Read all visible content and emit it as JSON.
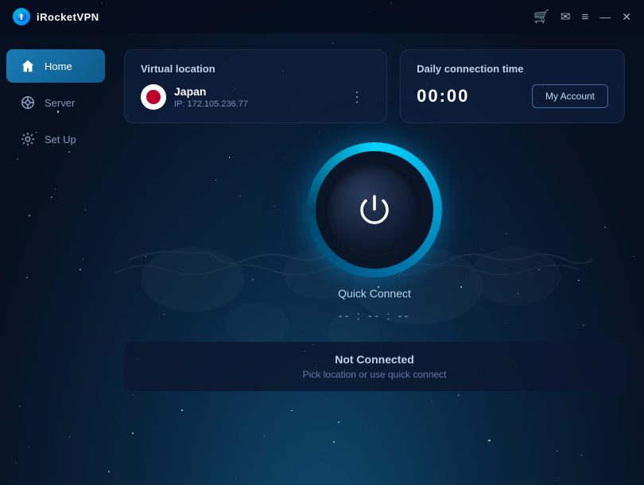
{
  "app": {
    "title": "iRocketVPN",
    "logo_char": "🚀"
  },
  "titlebar": {
    "cart_icon": "🛒",
    "mail_icon": "✉",
    "menu_icon": "≡",
    "minimize_icon": "—",
    "close_icon": "✕"
  },
  "sidebar": {
    "items": [
      {
        "id": "home",
        "label": "Home",
        "icon": "🏠",
        "active": true
      },
      {
        "id": "server",
        "label": "Server",
        "icon": "⊙",
        "active": false
      },
      {
        "id": "setup",
        "label": "Set Up",
        "icon": "⚙",
        "active": false
      }
    ]
  },
  "virtual_location": {
    "card_label": "Virtual location",
    "country": "Japan",
    "ip": "IP: 172.105.236.77",
    "flag": "🇯🇵",
    "menu_icon": "⋮"
  },
  "daily_connection": {
    "card_label": "Daily connection time",
    "time": "00:00",
    "my_account_label": "My Account"
  },
  "power": {
    "quick_connect_label": "Quick Connect",
    "timer": "-- : -- : --"
  },
  "status": {
    "title": "Not Connected",
    "subtitle": "Pick location or use quick connect"
  },
  "colors": {
    "accent": "#00c8f0",
    "bg_dark": "#071020",
    "card_bg": "rgba(15,30,60,0.75)"
  }
}
